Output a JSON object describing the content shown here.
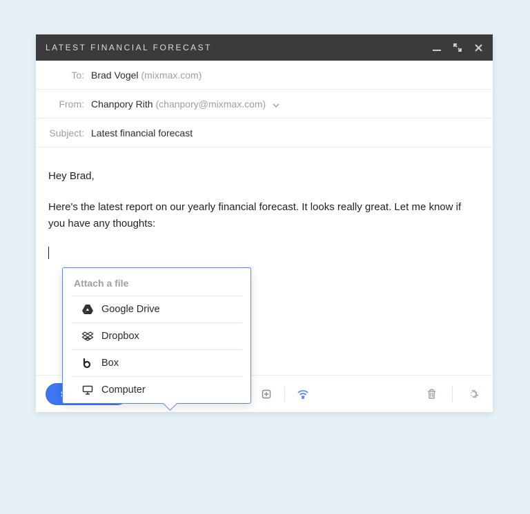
{
  "window": {
    "title": "LATEST FINANCIAL FORECAST"
  },
  "fields": {
    "to_label": "To:",
    "to_name": "Brad Vogel",
    "to_domain": "(mixmax.com)",
    "from_label": "From:",
    "from_name": "Chanpory Rith",
    "from_email": "(chanpory@mixmax.com)",
    "subject_label": "Subject:",
    "subject_value": "Latest financial forecast"
  },
  "body": {
    "greeting": "Hey Brad,",
    "paragraph": "Here's the latest report on our yearly financial forecast. It looks really great. Let me know if you have any thoughts:"
  },
  "attach_popover": {
    "title": "Attach a file",
    "items": [
      {
        "label": "Google Drive",
        "icon": "google-drive-icon"
      },
      {
        "label": "Dropbox",
        "icon": "dropbox-icon"
      },
      {
        "label": "Box",
        "icon": "box-icon"
      },
      {
        "label": "Computer",
        "icon": "computer-icon"
      }
    ]
  },
  "footer": {
    "send_label": "SEND NOW"
  },
  "colors": {
    "accent": "#3f76f0",
    "popover_border": "#5a86f0",
    "titlebar_bg": "#3b3b3b"
  }
}
